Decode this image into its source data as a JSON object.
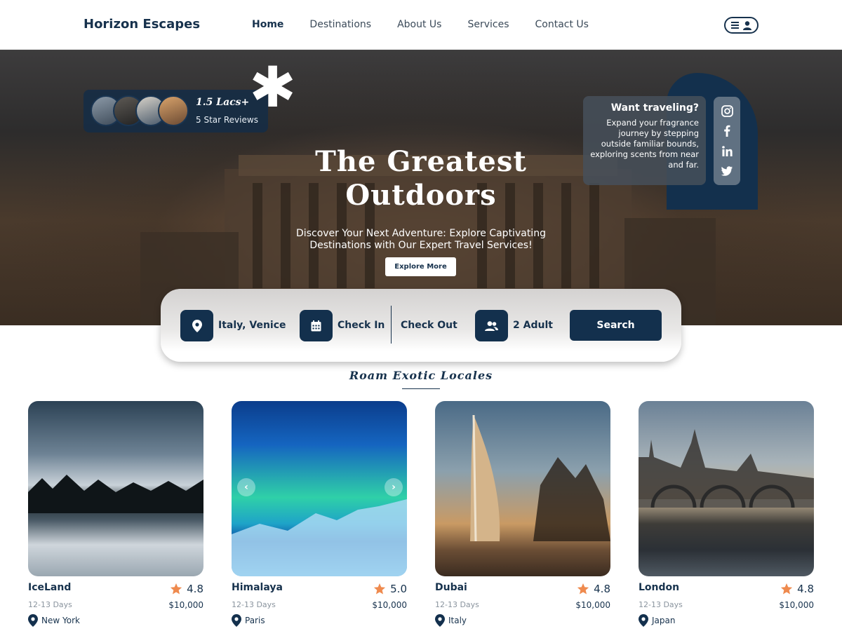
{
  "header": {
    "brand": "Horizon Escapes",
    "nav": [
      "Home",
      "Destinations",
      "About Us",
      "Services",
      "Contact Us"
    ],
    "active_nav": "Home"
  },
  "hero": {
    "reviews_count": "1.5 Lacs+",
    "reviews_label": "5 Star Reviews",
    "title_line1": "The Greatest",
    "title_line2": "Outdoors",
    "subtitle": "Discover Your Next Adventure: Explore Captivating Destinations with Our Expert Travel Services!",
    "cta_label": "Explore More",
    "promo_title": "Want traveling?",
    "promo_text": "Expand your fragrance journey by stepping outside familiar bounds, exploring scents from near and far.",
    "social_icons": [
      "instagram-icon",
      "facebook-icon",
      "linkedin-icon",
      "twitter-icon"
    ]
  },
  "search": {
    "location": "Italy, Venice",
    "check_in": "Check In",
    "check_out": "Check Out",
    "guests": "2 Adult",
    "button": "Search"
  },
  "section": {
    "title": "Roam Exotic Locales"
  },
  "destinations": [
    {
      "name": "IceLand",
      "rating": "4.8",
      "days": "12-13 Days",
      "price": "$10,000",
      "location": "New York"
    },
    {
      "name": "Himalaya",
      "rating": "5.0",
      "days": "12-13 Days",
      "price": "$10,000",
      "location": "Paris"
    },
    {
      "name": "Dubai",
      "rating": "4.8",
      "days": "12-13 Days",
      "price": "$10,000",
      "location": "Italy"
    },
    {
      "name": "London",
      "rating": "4.8",
      "days": "12-13 Days",
      "price": "$10,000",
      "location": "Japan"
    }
  ],
  "colors": {
    "primary": "#13304d",
    "star": "#ef8a4e",
    "text": "#17324d",
    "muted": "#8a949e"
  }
}
